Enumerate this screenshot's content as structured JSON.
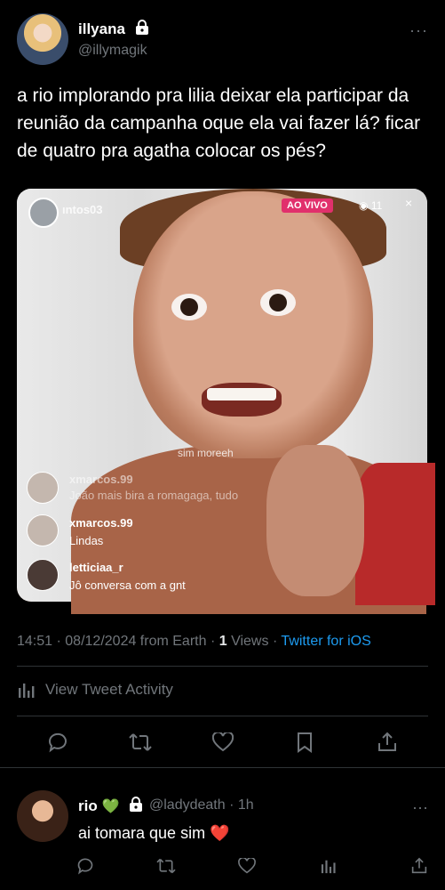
{
  "tweet": {
    "display_name": "illyana",
    "handle": "@illymagik",
    "more": "···",
    "text": "a rio implorando pra lilia deixar ela participar da reunião da campanha oque ela vai fazer lá? ficar de quatro pra agatha colocar os pés?",
    "time": "14:51",
    "date": "08/12/2024 from Earth",
    "views_count": "1",
    "views_label": "Views",
    "source": "Twitter for iOS",
    "activity_label": "View Tweet Activity"
  },
  "media": {
    "live_user": "ıntos03",
    "live_badge": "AO VIVO",
    "viewers": "11",
    "close": "×",
    "pill": "sim moreeh",
    "comments": [
      {
        "user": "xmarcos.99",
        "text": "João mais bira a romagaga, tudo"
      },
      {
        "user": "xmarcos.99",
        "text": "Lindas"
      },
      {
        "user": "letticiaa_r",
        "text": "Jô conversa com a gnt"
      }
    ]
  },
  "reply": {
    "display_name": "rio",
    "heart_emoji": "💚",
    "handle": "@ladydeath",
    "time": "· 1h",
    "more": "···",
    "text": "ai tomara que sim",
    "text_emoji": "❤️"
  },
  "colors": {
    "accent": "#1d9bf0",
    "muted": "#71767b",
    "live": "#e1306c"
  }
}
